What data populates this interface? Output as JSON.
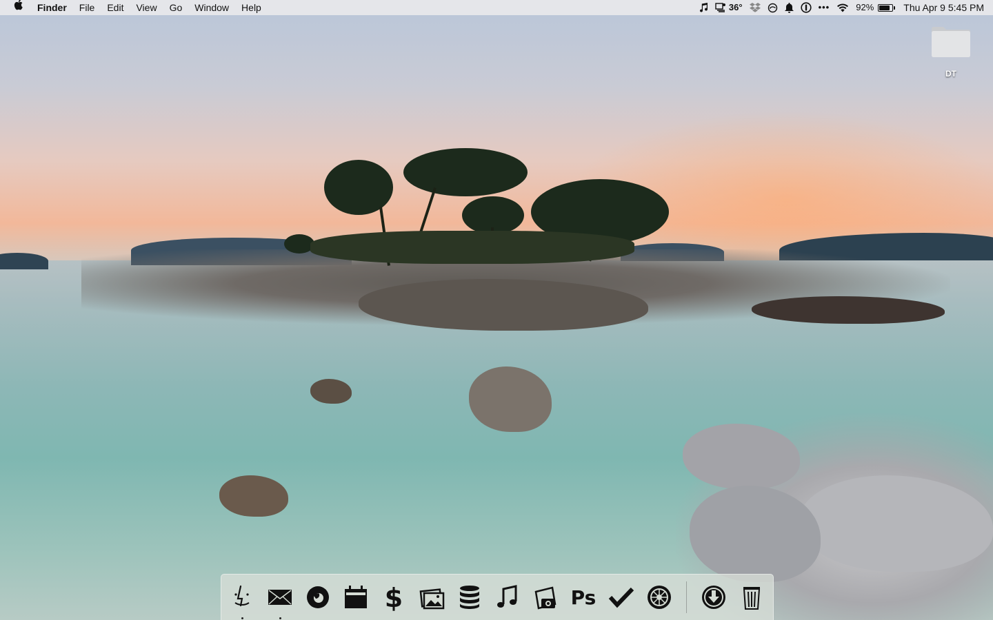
{
  "menubar": {
    "app_name": "Finder",
    "menus": [
      "File",
      "Edit",
      "View",
      "Go",
      "Window",
      "Help"
    ],
    "status": {
      "weather": "36°",
      "battery_percent": "92%",
      "battery_level": 0.92,
      "clock": "Thu Apr 9  5:45 PM"
    },
    "status_icons": [
      "music-note-icon",
      "weather-icon",
      "dropbox-icon",
      "sync-icon",
      "notification-bell-icon",
      "password-icon",
      "more-icon",
      "wifi-icon",
      "battery-icon"
    ]
  },
  "desktop": {
    "folder": {
      "label": "DT",
      "icon": "folder-icon"
    }
  },
  "dock": {
    "apps": [
      {
        "name": "finder",
        "icon": "finder-icon",
        "running": true
      },
      {
        "name": "mail",
        "icon": "mail-icon",
        "running": true
      },
      {
        "name": "firefox",
        "icon": "firefox-icon",
        "running": false
      },
      {
        "name": "calendar",
        "icon": "calendar-icon",
        "running": false
      },
      {
        "name": "finance",
        "icon": "dollar-icon",
        "running": false
      },
      {
        "name": "photos",
        "icon": "photos-icon",
        "running": false
      },
      {
        "name": "database",
        "icon": "database-icon",
        "running": false
      },
      {
        "name": "music",
        "icon": "music-icon",
        "running": false
      },
      {
        "name": "screenshot",
        "icon": "camera-icon",
        "running": false
      },
      {
        "name": "photoshop",
        "icon": "photoshop-icon",
        "running": false,
        "label": "Ps"
      },
      {
        "name": "tasks",
        "icon": "checkmark-icon",
        "running": false
      },
      {
        "name": "system-preferences",
        "icon": "settings-icon",
        "running": false
      }
    ],
    "stacks": [
      {
        "name": "downloads",
        "icon": "downloads-icon"
      },
      {
        "name": "trash",
        "icon": "trash-icon"
      }
    ]
  }
}
